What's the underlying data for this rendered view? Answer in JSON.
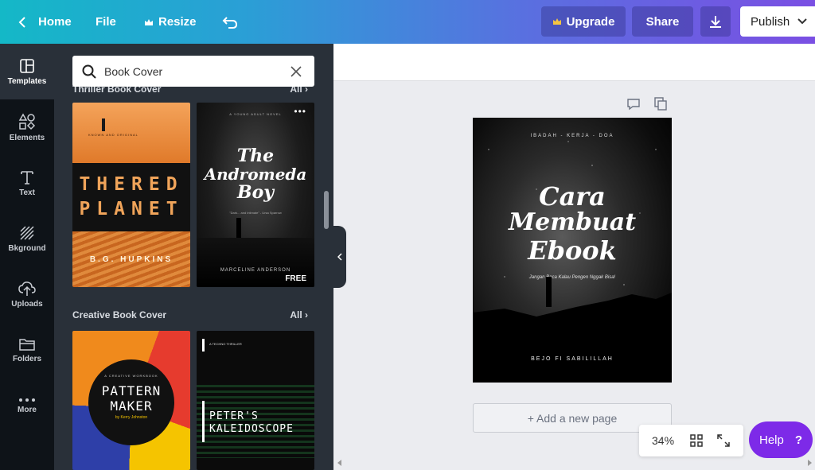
{
  "topbar": {
    "home_label": "Home",
    "file_label": "File",
    "resize_label": "Resize",
    "upgrade_label": "Upgrade",
    "share_label": "Share",
    "publish_label": "Publish"
  },
  "rail": {
    "items": [
      {
        "label": "Templates",
        "icon": "templates-icon"
      },
      {
        "label": "Elements",
        "icon": "elements-icon"
      },
      {
        "label": "Text",
        "icon": "text-icon"
      },
      {
        "label": "Bkground",
        "icon": "background-icon"
      },
      {
        "label": "Uploads",
        "icon": "uploads-icon"
      },
      {
        "label": "Folders",
        "icon": "folders-icon"
      },
      {
        "label": "More",
        "icon": "more-icon"
      }
    ]
  },
  "panel": {
    "search_value": "Book Cover",
    "section1": {
      "title": "Thriller Book Cover",
      "all": "All"
    },
    "section2": {
      "title": "Creative Book Cover",
      "all": "All"
    },
    "thumbs": {
      "red_planet": {
        "line1": "THERED",
        "line2": "PLANET",
        "author": "B.G. HUPKINS",
        "tag": "KNOWN AND ORIGINAL"
      },
      "andromeda": {
        "series": "A YOUNG ADULT NOVEL",
        "title1": "The",
        "title2": "Andromeda",
        "title3": "Boy",
        "quote": "\"Dark... and intimate\" - Ursa Sparrow",
        "author": "MARCELINE ANDERSON",
        "badge": "FREE"
      },
      "pattern": {
        "kicker": "A CREATIVE WORKBOOK",
        "title1": "PATTERN",
        "title2": "MAKER",
        "author": "by Kerry Johnston"
      },
      "peter": {
        "kicker": "A TECHNO THRILLER",
        "title1": "PETER'S",
        "title2": "KALEIDOSCOPE"
      }
    }
  },
  "page": {
    "top": "IBADAH - KERJA - DOA",
    "title1": "Cara",
    "title2": "Membuat",
    "title3": "Ebook",
    "subtitle": "Jangan Baca Kalau Pengen Nggak Bisa!",
    "author": "BEJO FI SABILILLAH"
  },
  "add_page_label": "+ Add a new page",
  "zoom_label": "34%",
  "help_label": "Help",
  "help_glyph": "?"
}
